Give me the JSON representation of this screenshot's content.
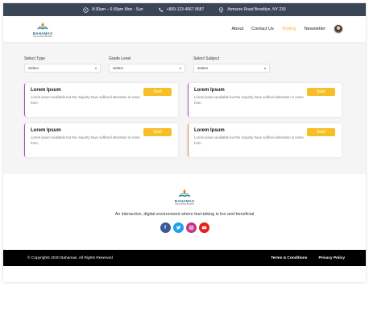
{
  "topbar": {
    "hours": "8:30am – 6:30pm Mon - Sun",
    "phone": "+809-123-4567 8587",
    "address": "Armsore Road Brooklyn, NY 230"
  },
  "brand": {
    "name": "BAHAMAS",
    "tagline": "EDUCATION BOARD"
  },
  "nav": {
    "items": [
      "About",
      "Contact Us",
      "Testing",
      "Newsletter"
    ],
    "active": "Testing"
  },
  "filters": [
    {
      "label": "Select Type",
      "value": "Select"
    },
    {
      "label": "Grade Level",
      "value": "Select"
    },
    {
      "label": "Select Subject",
      "value": "Select"
    }
  ],
  "cards": [
    {
      "title": "Lorem Ipsum",
      "desc": "Lorem ipsum available but the majority have suffered alteration in some form.",
      "button": "Start",
      "accent": "#a052b5"
    },
    {
      "title": "Lorem Ipsum",
      "desc": "Lorem ipsum available but the majority have suffered alteration in some form.",
      "button": "Start",
      "accent": "#a052b5"
    },
    {
      "title": "Lorem Ipsum",
      "desc": "Lorem ipsum available but the majority have suffered alteration in some form.",
      "button": "Start",
      "accent": "#a052b5"
    },
    {
      "title": "Lorem Ipsum",
      "desc": "Lorem ipsum available but the majority have suffered alteration in some form.",
      "button": "Start",
      "accent": "#f07a3f"
    }
  ],
  "footer": {
    "tagline": "An interactive, digital environment where test-taking is fun and beneficial",
    "socials": [
      "facebook-icon",
      "twitter-icon",
      "instagram-icon",
      "youtube-icon"
    ],
    "copyright": "© Copyrights 2020 Bahamas. All Rights Reserved",
    "links": [
      "Terms & Conditions",
      "Privacy Policy"
    ]
  },
  "colors": {
    "topbar": "#3a4656",
    "accent": "#f7bf27",
    "active_nav": "#f4b91f",
    "card_purple": "#a052b5",
    "card_orange": "#f07a3f"
  }
}
